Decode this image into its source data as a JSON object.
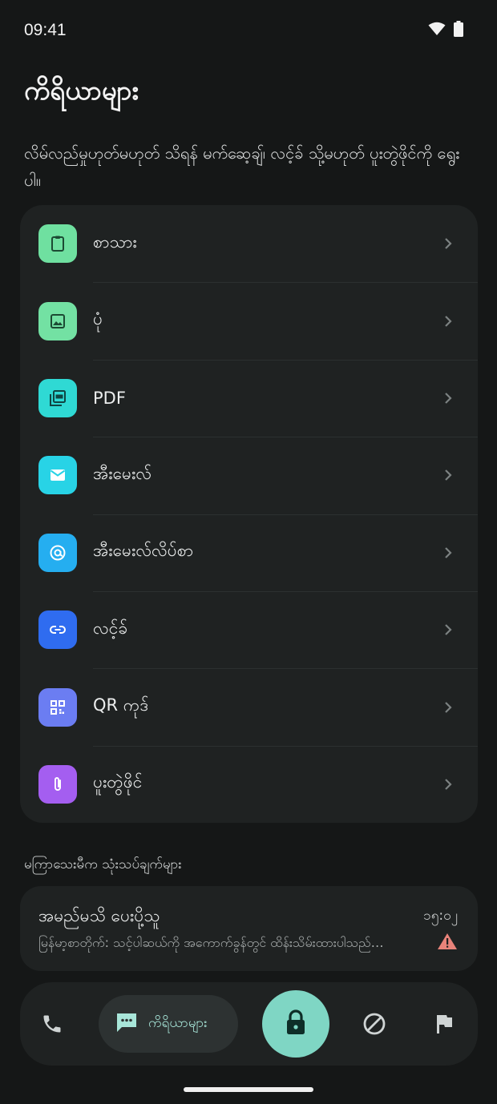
{
  "status": {
    "time": "09:41"
  },
  "page": {
    "title": "ကိရိယာများ",
    "subtitle": "လိမ်လည်မှုဟုတ်မဟုတ် သိရန် မက်ဆေ့ချ်၊ လင့်ခ် သို့မဟုတ် ပူးတွဲဖိုင်ကို ရွေးပါ။"
  },
  "menu": {
    "items": [
      {
        "label": "စာသား",
        "icon": "clipboard-icon",
        "color": "#6fe0a0"
      },
      {
        "label": "ပုံ",
        "icon": "image-icon",
        "color": "#73e1a3"
      },
      {
        "label": "PDF",
        "icon": "pdf-icon",
        "color": "#2fd9d4"
      },
      {
        "label": "အီးမေးလ်",
        "icon": "mail-icon",
        "color": "#28d3e6"
      },
      {
        "label": "အီးမေးလ်လိပ်စာ",
        "icon": "at-icon",
        "color": "#25aef0"
      },
      {
        "label": "လင့်ခ်",
        "icon": "link-icon",
        "color": "#2f6cf0"
      },
      {
        "label": "QR ကုဒ်",
        "icon": "qr-code-icon",
        "color": "#6b7df2"
      },
      {
        "label": "ပူးတွဲဖိုင်",
        "icon": "paperclip-icon",
        "color": "#a45ef0"
      }
    ]
  },
  "recent": {
    "heading": "မကြာသေးမီက သုံးသပ်ချက်များ",
    "item": {
      "name": "အမည်မသိ ပေးပို့သူ",
      "preview": "မြန်မာ့စာတိုက်: သင့်ပါဆယ်ကို အကောက်ခွန်တွင် ထိန်းသိမ်းထားပါသည်…",
      "time": "၁၅:၀၂",
      "warning_color": "#e8837a"
    }
  },
  "bottom_nav": {
    "tools_label": "ကိရိယာများ",
    "accent": "#7fd6c4"
  }
}
